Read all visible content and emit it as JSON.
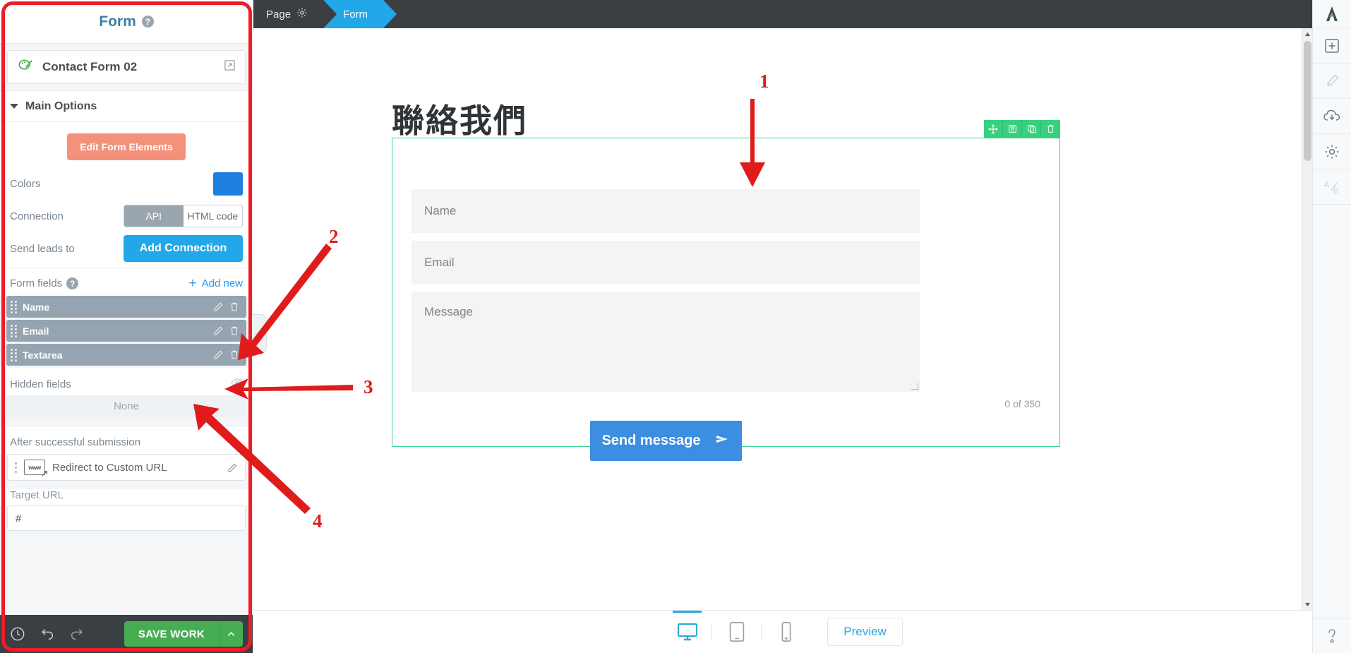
{
  "sidebar": {
    "title": "Form",
    "help_icon": "?",
    "template": {
      "name": "Contact Form 02",
      "open_icon": "external-link"
    },
    "main_options": {
      "title": "Main Options"
    },
    "edit_elements_label": "Edit Form Elements",
    "colors_label": "Colors",
    "color_value": "#1e7fe0",
    "connection_label": "Connection",
    "connection_options": [
      "API",
      "HTML code"
    ],
    "connection_selected": "API",
    "send_leads_label": "Send leads to",
    "add_connection_label": "Add Connection",
    "form_fields_label": "Form fields",
    "add_new_label": "Add new",
    "fields": [
      {
        "name": "Name",
        "edit_icon": "pencil-icon",
        "delete_icon": "trash-icon"
      },
      {
        "name": "Email",
        "edit_icon": "pencil-icon",
        "delete_icon": "trash-icon"
      },
      {
        "name": "Textarea",
        "edit_icon": "pencil-icon",
        "delete_icon": "trash-icon"
      }
    ],
    "hidden_fields_label": "Hidden fields",
    "hidden_fields_value": "None",
    "after_submission_label": "After successful submission",
    "redirect_label": "Redirect to Custom URL",
    "target_url_label": "Target URL",
    "target_url_value": "#",
    "footer": {
      "history_icon": "clock-icon",
      "undo_icon": "undo-icon",
      "redo_icon": "redo-icon",
      "save_label": "SAVE WORK",
      "save_caret": "chevron-up-icon"
    }
  },
  "topbar": {
    "crumbs": [
      {
        "label": "Page",
        "icon": "gear-icon",
        "active": false
      },
      {
        "label": "Form",
        "icon": "",
        "active": true
      }
    ]
  },
  "canvas": {
    "heading": "聯絡我們",
    "element_tools": [
      "move-icon",
      "save-icon",
      "duplicate-icon",
      "trash-icon"
    ],
    "fields": [
      {
        "placeholder": "Name"
      },
      {
        "placeholder": "Email"
      },
      {
        "placeholder": "Message"
      }
    ],
    "counter": "0 of 350",
    "submit_label": "Send message",
    "submit_icon": "send-arrow-icon"
  },
  "bottombar": {
    "devices": [
      {
        "name": "desktop",
        "active": true
      },
      {
        "name": "tablet",
        "active": false
      },
      {
        "name": "mobile",
        "active": false
      }
    ],
    "preview_label": "Preview"
  },
  "rail": {
    "items": [
      "logo-icon",
      "add-icon",
      "brush-icon",
      "cloud-download-icon",
      "gear-icon",
      "ab-test-icon",
      "help-icon"
    ]
  },
  "annotations": [
    {
      "number": "1"
    },
    {
      "number": "2"
    },
    {
      "number": "3"
    },
    {
      "number": "4"
    }
  ]
}
